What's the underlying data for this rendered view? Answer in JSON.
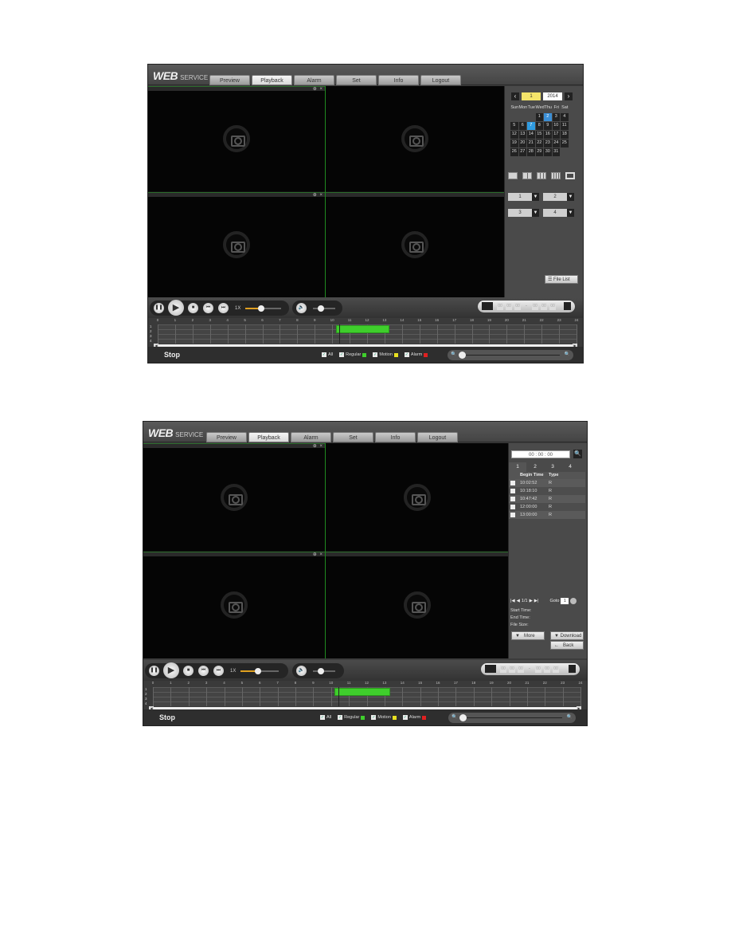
{
  "header": {
    "logo_main": "WEB",
    "logo_sub": "SERVICE",
    "tabs": [
      "Preview",
      "Playback",
      "Alarm",
      "Set",
      "Info",
      "Logout"
    ],
    "active_tab": "Playback"
  },
  "video": {
    "pane_controls": "⊕ ×",
    "panes": 4
  },
  "calendar": {
    "prev": "‹",
    "next": "›",
    "month": "1",
    "year": "2014",
    "weekdays": [
      "Sun",
      "Mon",
      "Tue",
      "Wed",
      "Thu",
      "Fri",
      "Sat"
    ],
    "leading_blanks": 3,
    "days": 31,
    "recorded_days": [
      2
    ],
    "selected_day": 7
  },
  "layout_buttons": [
    "1-window",
    "4-window",
    "9-window",
    "16-window",
    "fullscreen"
  ],
  "channels": [
    {
      "value": "1",
      "dd": "▼"
    },
    {
      "value": "2",
      "dd": "▼"
    },
    {
      "value": "3",
      "dd": "▼"
    },
    {
      "value": "4",
      "dd": "▼"
    }
  ],
  "file_list_button": "File List",
  "controls": {
    "speed": "1X",
    "play_progress": 0.45,
    "volume": 0.35,
    "icons": {
      "pause": "❚❚",
      "play": "▶",
      "stop": "■",
      "prev_frame": "⏮",
      "next_frame": "⏭",
      "volume": "🔈"
    },
    "clip_fields": [
      "00",
      "00",
      "00",
      "00",
      "00",
      "00"
    ],
    "clip_sep": "-"
  },
  "timeline": {
    "hours": [
      "0",
      "1",
      "2",
      "3",
      "4",
      "5",
      "6",
      "7",
      "8",
      "9",
      "10",
      "11",
      "12",
      "13",
      "14",
      "15",
      "16",
      "17",
      "18",
      "19",
      "20",
      "21",
      "22",
      "23",
      "24"
    ],
    "channels": [
      "1",
      "2",
      "3",
      "4"
    ],
    "records": [
      {
        "channel": 1,
        "start_hour": 10.2,
        "end_hour": 13.3
      }
    ],
    "cursor_hour": 10.4,
    "scroll_left": "◀",
    "scroll_right": "▶"
  },
  "status": {
    "state": "Stop",
    "legend": [
      {
        "label": "All",
        "checked": true,
        "color": null
      },
      {
        "label": "Regular",
        "checked": true,
        "color": "#3fce2c"
      },
      {
        "label": "Motion",
        "checked": true,
        "color": "#e8e020"
      },
      {
        "label": "Alarm",
        "checked": true,
        "color": "#e02020"
      }
    ],
    "zoom_level": 0.0
  },
  "file_search": {
    "time_value": "00 : 00 : 00",
    "search_icon": "🔍",
    "channel_tabs": [
      "1",
      "2",
      "3",
      "4"
    ],
    "active_channel": "1",
    "columns": [
      "Begin Time",
      "Type"
    ],
    "rows": [
      {
        "time": "10:02:52",
        "type": "R"
      },
      {
        "time": "10:18:10",
        "type": "R"
      },
      {
        "time": "10:47:42",
        "type": "R"
      },
      {
        "time": "12:00:00",
        "type": "R"
      },
      {
        "time": "13:00:00",
        "type": "R"
      }
    ],
    "pager": {
      "first": "|◀",
      "prev": "◀",
      "page": "1/1",
      "next": "▶",
      "last": "▶|",
      "goto_label": "Goto",
      "goto_value": "1"
    },
    "start_time_label": "Start Time:",
    "end_time_label": "End Time:",
    "file_size_label": "File Size:",
    "more_button": "More",
    "download_button": "Download",
    "back_button": "Back"
  }
}
